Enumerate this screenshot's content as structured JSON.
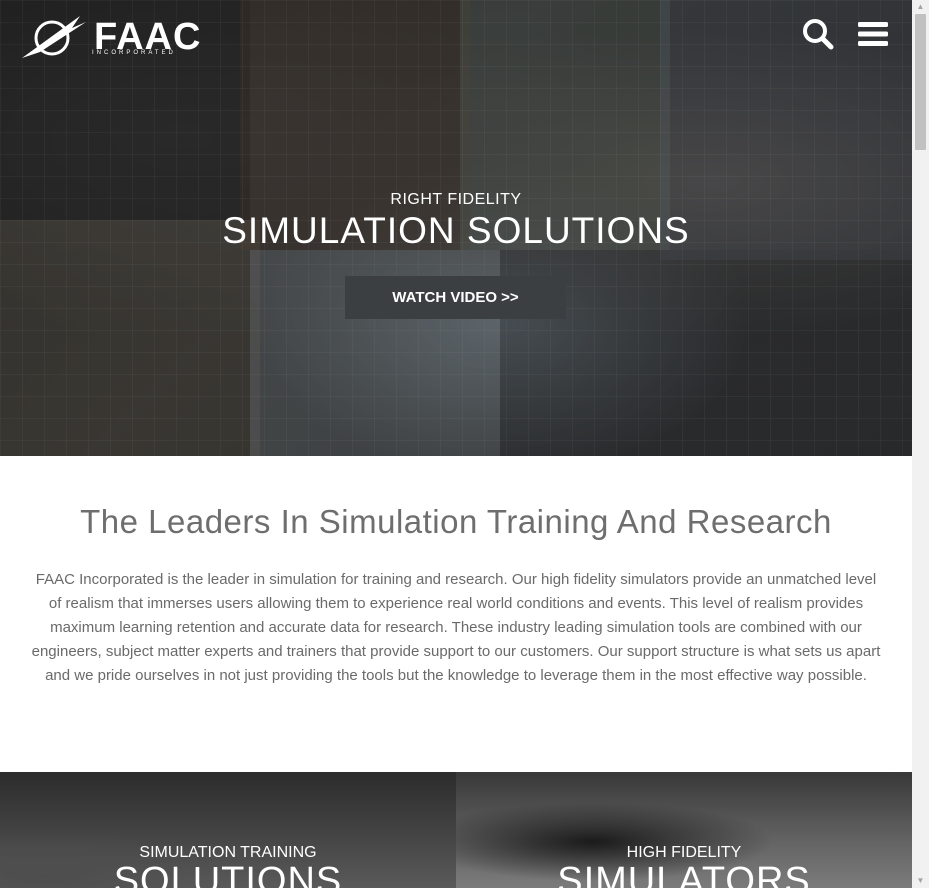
{
  "header": {
    "logo_text": "FAAC",
    "logo_subtext": "INCORPORATED",
    "search_icon": "search-icon",
    "menu_icon": "hamburger-menu-icon"
  },
  "hero": {
    "kicker": "RIGHT FIDELITY",
    "title": "SIMULATION SOLUTIONS",
    "button_label": "WATCH VIDEO >>"
  },
  "intro": {
    "title": "The Leaders In Simulation Training And Research",
    "body": "FAAC Incorporated is the leader in simulation for training and research. Our high fidelity simulators provide an unmatched level of realism that immerses users allowing them to experience real world conditions and events. This level of realism provides maximum learning retention and accurate data for research. These industry leading simulation tools are combined with our engineers, subject matter experts and trainers that provide support to our customers. Our support structure is what sets us apart and we pride ourselves in not just providing the tools but the knowledge to leverage them in the most effective way possible."
  },
  "tiles": [
    {
      "kicker": "SIMULATION TRAINING",
      "title": "SOLUTIONS"
    },
    {
      "kicker": "HIGH FIDELITY",
      "title": "SIMULATORS"
    }
  ],
  "colors": {
    "button_bg": "#3c3f42",
    "heading_gray": "#6e6e6e",
    "body_gray": "#6a6a6a"
  }
}
